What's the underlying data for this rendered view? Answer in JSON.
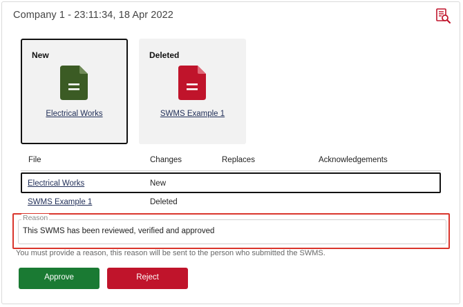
{
  "header": {
    "title": "Company 1 - 23:11:34, 18 Apr 2022",
    "report_icon": "document-search-icon"
  },
  "cards": [
    {
      "status": "New",
      "file_name": "Electrical Works",
      "icon": "file-icon",
      "color": "#3b5b24"
    },
    {
      "status": "Deleted",
      "file_name": "SWMS Example 1",
      "icon": "file-icon",
      "color": "#c0142b"
    }
  ],
  "table": {
    "headers": [
      "File",
      "Changes",
      "Replaces",
      "Acknowledgements"
    ],
    "rows": [
      {
        "file": "Electrical Works",
        "changes": "New",
        "replaces": "",
        "acknowledgements": ""
      },
      {
        "file": "SWMS Example 1",
        "changes": "Deleted",
        "replaces": "",
        "acknowledgements": ""
      }
    ]
  },
  "reason": {
    "label": "Reason",
    "value": "This SWMS has been reviewed, verified and approved",
    "helper": "You must provide a reason, this reason will be sent to the person who submitted the SWMS."
  },
  "actions": {
    "approve_label": "Approve",
    "reject_label": "Reject"
  },
  "colors": {
    "approve": "#1a7a33",
    "reject": "#c0142b",
    "highlight": "#d9342b",
    "link": "#1f2d57"
  }
}
